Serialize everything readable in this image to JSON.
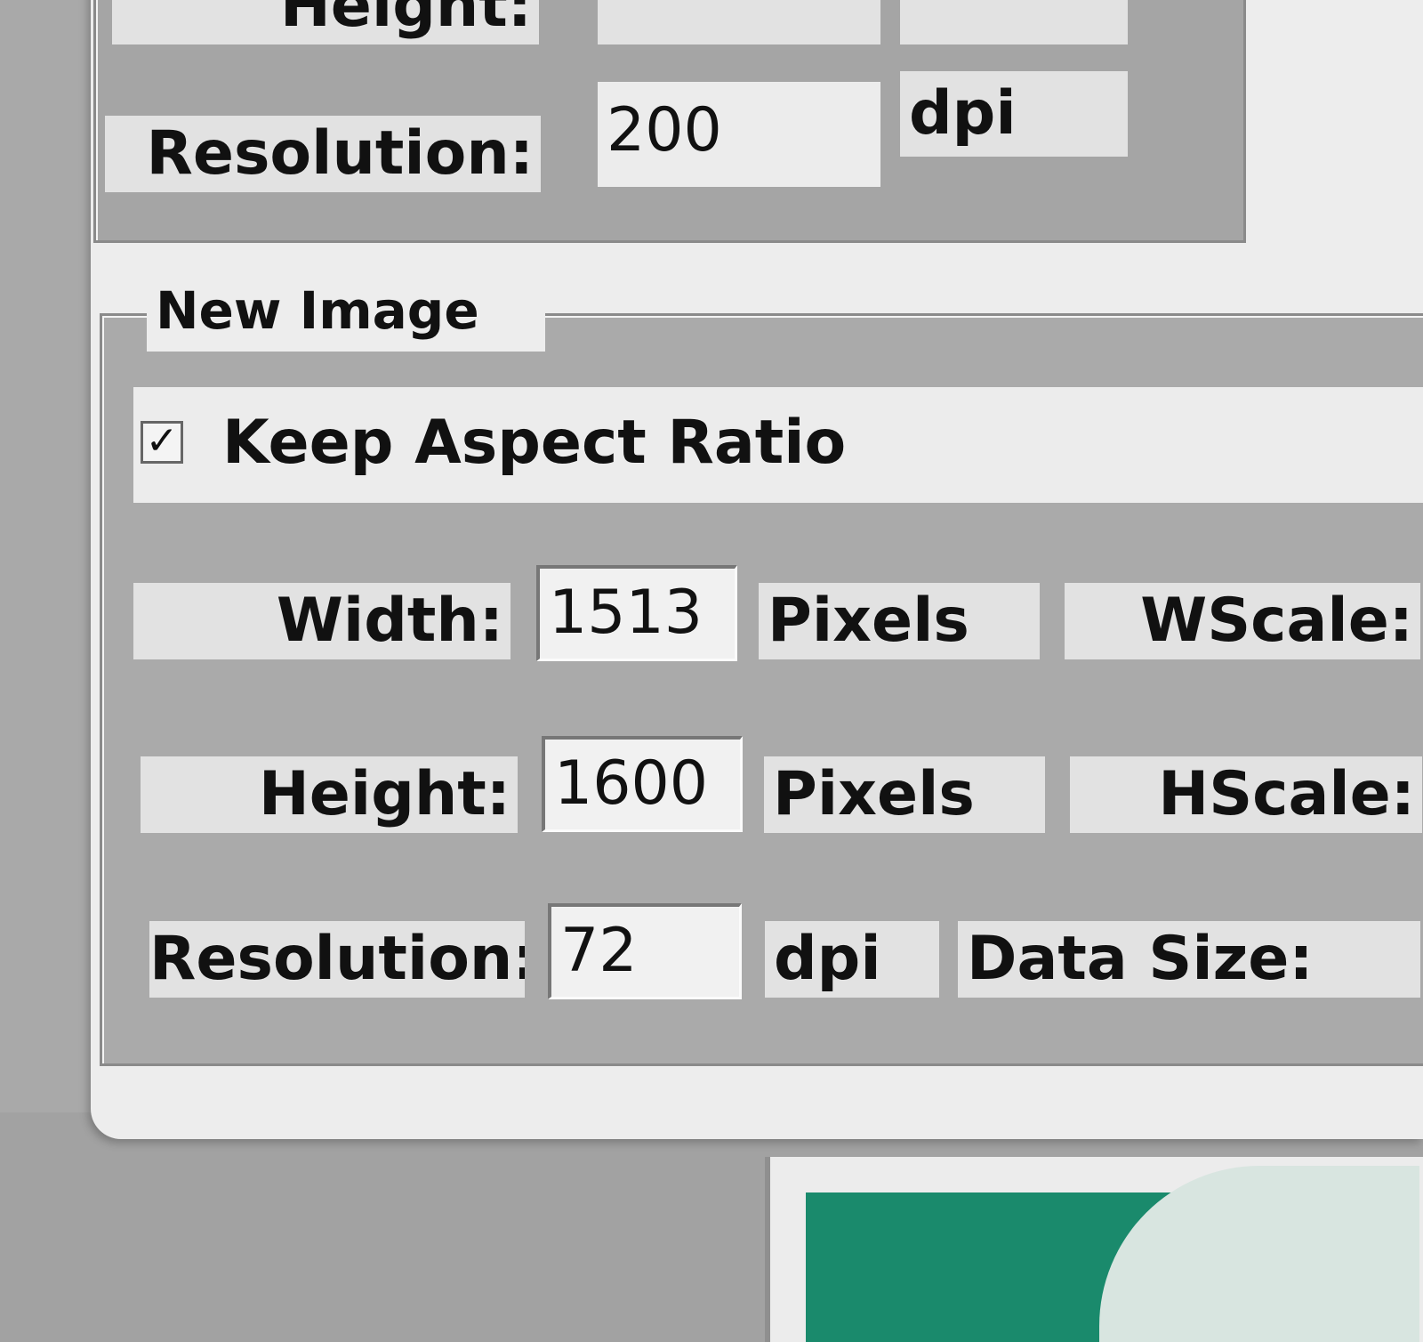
{
  "original": {
    "height_label": "Height:",
    "resolution_label": "Resolution:",
    "resolution_value": "200",
    "resolution_unit": "dpi"
  },
  "new_image": {
    "group_title": "New Image",
    "keep_aspect_ratio": {
      "label": "Keep Aspect Ratio",
      "checked": true,
      "check_glyph": "✓"
    },
    "width": {
      "label": "Width:",
      "value": "1513",
      "unit": "Pixels"
    },
    "wscale_label": "WScale:",
    "height": {
      "label": "Height:",
      "value": "1600",
      "unit": "Pixels"
    },
    "hscale_label": "HScale:",
    "resolution": {
      "label": "Resolution:",
      "value": "72",
      "unit": "dpi"
    },
    "data_size_label": "Data Size:"
  },
  "icons": {
    "checkbox": "checkbox-checked-icon"
  },
  "colors": {
    "dialog_bg": "#ededed",
    "group_bg": "#aaaaaa",
    "text": "#111111",
    "preview_green": "#1a8a6c"
  }
}
